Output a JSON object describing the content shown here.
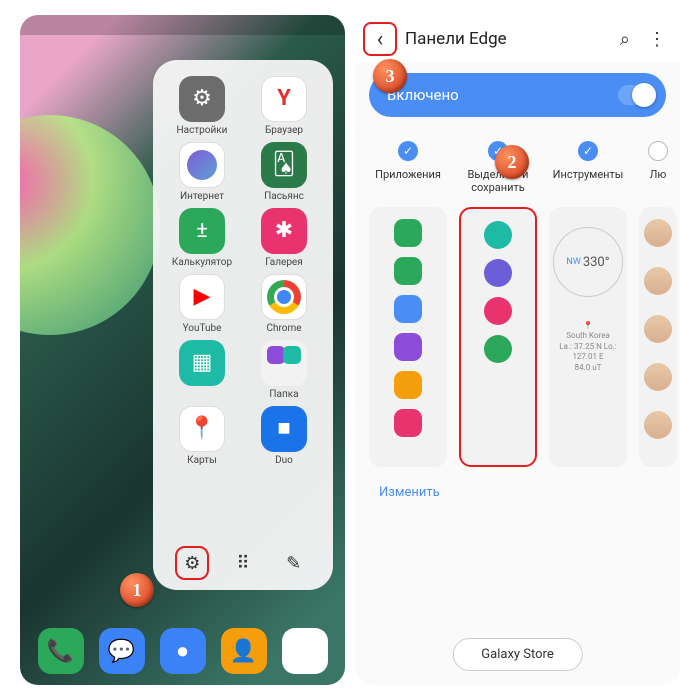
{
  "left": {
    "apps": [
      {
        "label": "Настройки",
        "cls": "i-settings",
        "glyph": "⚙"
      },
      {
        "label": "Браузер",
        "cls": "i-browser",
        "glyph": "Y"
      },
      {
        "label": "Интернет",
        "cls": "i-internet",
        "glyph": ""
      },
      {
        "label": "Пасьянс",
        "cls": "i-cards",
        "glyph": "🂡"
      },
      {
        "label": "Калькулятор",
        "cls": "i-calc",
        "glyph": "±"
      },
      {
        "label": "Галерея",
        "cls": "i-gallery",
        "glyph": "✱"
      },
      {
        "label": "YouTube",
        "cls": "i-youtube",
        "glyph": "▶"
      },
      {
        "label": "Chrome",
        "cls": "i-chrome",
        "glyph": ""
      },
      {
        "label": "",
        "cls": "i-folder",
        "glyph": "▦"
      },
      {
        "label": "Папка",
        "cls": "i-folder2",
        "glyph": ""
      },
      {
        "label": "Карты",
        "cls": "i-maps",
        "glyph": "📍"
      },
      {
        "label": "Duo",
        "cls": "i-duo",
        "glyph": "■"
      }
    ]
  },
  "right": {
    "title": "Панели Edge",
    "toggle": "Включено",
    "edit": "Изменить",
    "store": "Galaxy Store",
    "panels": [
      {
        "label": "Приложения",
        "checked": true
      },
      {
        "label": "Выделить и сохранить",
        "checked": true,
        "highlight": true
      },
      {
        "label": "Инструменты",
        "checked": true
      },
      {
        "label": "Лю",
        "checked": false
      }
    ],
    "compass": {
      "dir": "NW",
      "deg": "330°",
      "loc": "South Korea",
      "coords": "La.: 37.25 N Lo.: 127.01 E",
      "extra": "84.0 uT"
    }
  },
  "badges": {
    "b1": "1",
    "b2": "2",
    "b3": "3"
  }
}
